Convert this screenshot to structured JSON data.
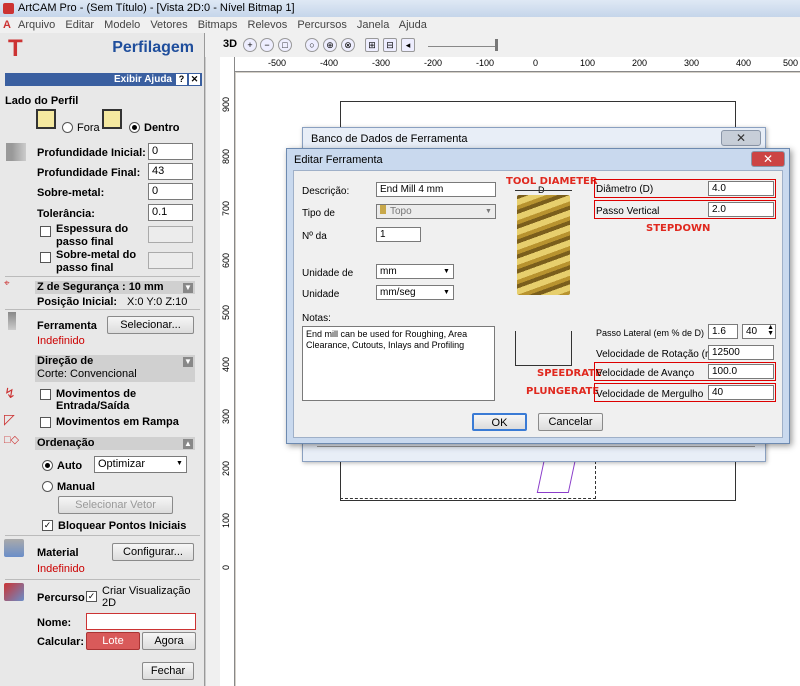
{
  "window": {
    "title": "ArtCAM Pro - (Sem Título) - [Vista 2D:0 - Nível Bitmap 1]"
  },
  "menu": [
    "Arquivo",
    "Editar",
    "Modelo",
    "Vetores",
    "Bitmaps",
    "Relevos",
    "Percursos",
    "Janela",
    "Ajuda"
  ],
  "panel": {
    "title": "Perfilagem",
    "help_label": "Exibir Ajuda",
    "help_q": "?",
    "help_x": "✕",
    "lado_label": "Lado do Perfil",
    "fora": "Fora",
    "dentro": "Dentro",
    "prof_inicial_label": "Profundidade Inicial:",
    "prof_inicial": "0",
    "prof_final_label": "Profundidade Final:",
    "prof_final": "43",
    "sobre_metal_label": "Sobre-metal:",
    "sobre_metal": "0",
    "tolerancia_label": "Tolerância:",
    "tolerancia": "0.1",
    "espessura_l1": "Espessura do",
    "espessura_l2": "passo final",
    "sobremetal_final_l1": "Sobre-metal do",
    "sobremetal_final_l2": "passo final",
    "z_seg": "Z de Segurança : 10 mm",
    "posicao_inicial": "Posição Inicial:",
    "posicao_val": "X:0 Y:0 Z:10",
    "ferramenta_label": "Ferramenta",
    "selecionar": "Selecionar...",
    "indefinido": "Indefinido",
    "direcao_l1": "Direção de",
    "direcao_l2": "Corte: Convencional",
    "mov_entrada": "Movimentos de Entrada/Saída",
    "mov_rampa": "Movimentos em Rampa",
    "ordenacao": "Ordenação",
    "auto": "Auto",
    "optimizar": "Optimizar",
    "manual": "Manual",
    "selecionar_vetor": "Selecionar Vetor",
    "bloquear": "Bloquear Pontos Iniciais",
    "material_label": "Material",
    "configurar": "Configurar...",
    "material_indef": "Indefinido",
    "percurso_label": "Percurso",
    "criar_l1": "Criar Visualização",
    "criar_l2": "2D",
    "nome_label": "Nome:",
    "calcular_label": "Calcular:",
    "lote": "Lote",
    "agora": "Agora",
    "fechar": "Fechar"
  },
  "toolbar": {
    "label_3d": "3D"
  },
  "ruler": {
    "h": [
      "-500",
      "-400",
      "-300",
      "-200",
      "-100",
      "0",
      "100",
      "200",
      "300",
      "400",
      "500"
    ],
    "v": [
      "900",
      "800",
      "700",
      "600",
      "500",
      "400",
      "300",
      "200",
      "100",
      "0"
    ]
  },
  "db_dialog": {
    "title": "Banco de Dados de Ferramenta",
    "close": "✕"
  },
  "edit_dialog": {
    "title": "Editar Ferramenta",
    "close": "✕",
    "descricao_label": "Descrição:",
    "descricao": "End Mill 4 mm",
    "tipo_label": "Tipo de",
    "tipo": "Topo",
    "nda_label": "Nº da",
    "nda": "1",
    "unidade_de_label": "Unidade de",
    "unidade_de": "mm",
    "unidade_label": "Unidade",
    "unidade": "mm/seg",
    "notas_label": "Notas:",
    "notas": "End mill can be used for Roughing, Area Clearance, Cutouts, Inlays and Profiling",
    "diametro_label": "Diâmetro (D)",
    "diametro": "4.0",
    "passo_vertical_label": "Passo Vertical",
    "passo_vertical": "2.0",
    "passo_lateral_label": "Passo Lateral (em % de D)",
    "passo_lateral": "1.6",
    "passo_lateral_pct": "40",
    "rotacao_label": "Velocidade de Rotação (rpm)",
    "rotacao": "12500",
    "avanco_label": "Velocidade de Avanço",
    "avanco": "100.0",
    "mergulho_label": "Velocidade de Mergulho",
    "mergulho": "40",
    "d_label": "D",
    "ok": "OK",
    "cancelar": "Cancelar"
  },
  "annotations": {
    "tool_diameter": "TOOL DIAMETER",
    "stepdown": "STEPDOWN",
    "speedrate": "SPEEDRATE",
    "plungerate": "PLUNGERATE"
  }
}
